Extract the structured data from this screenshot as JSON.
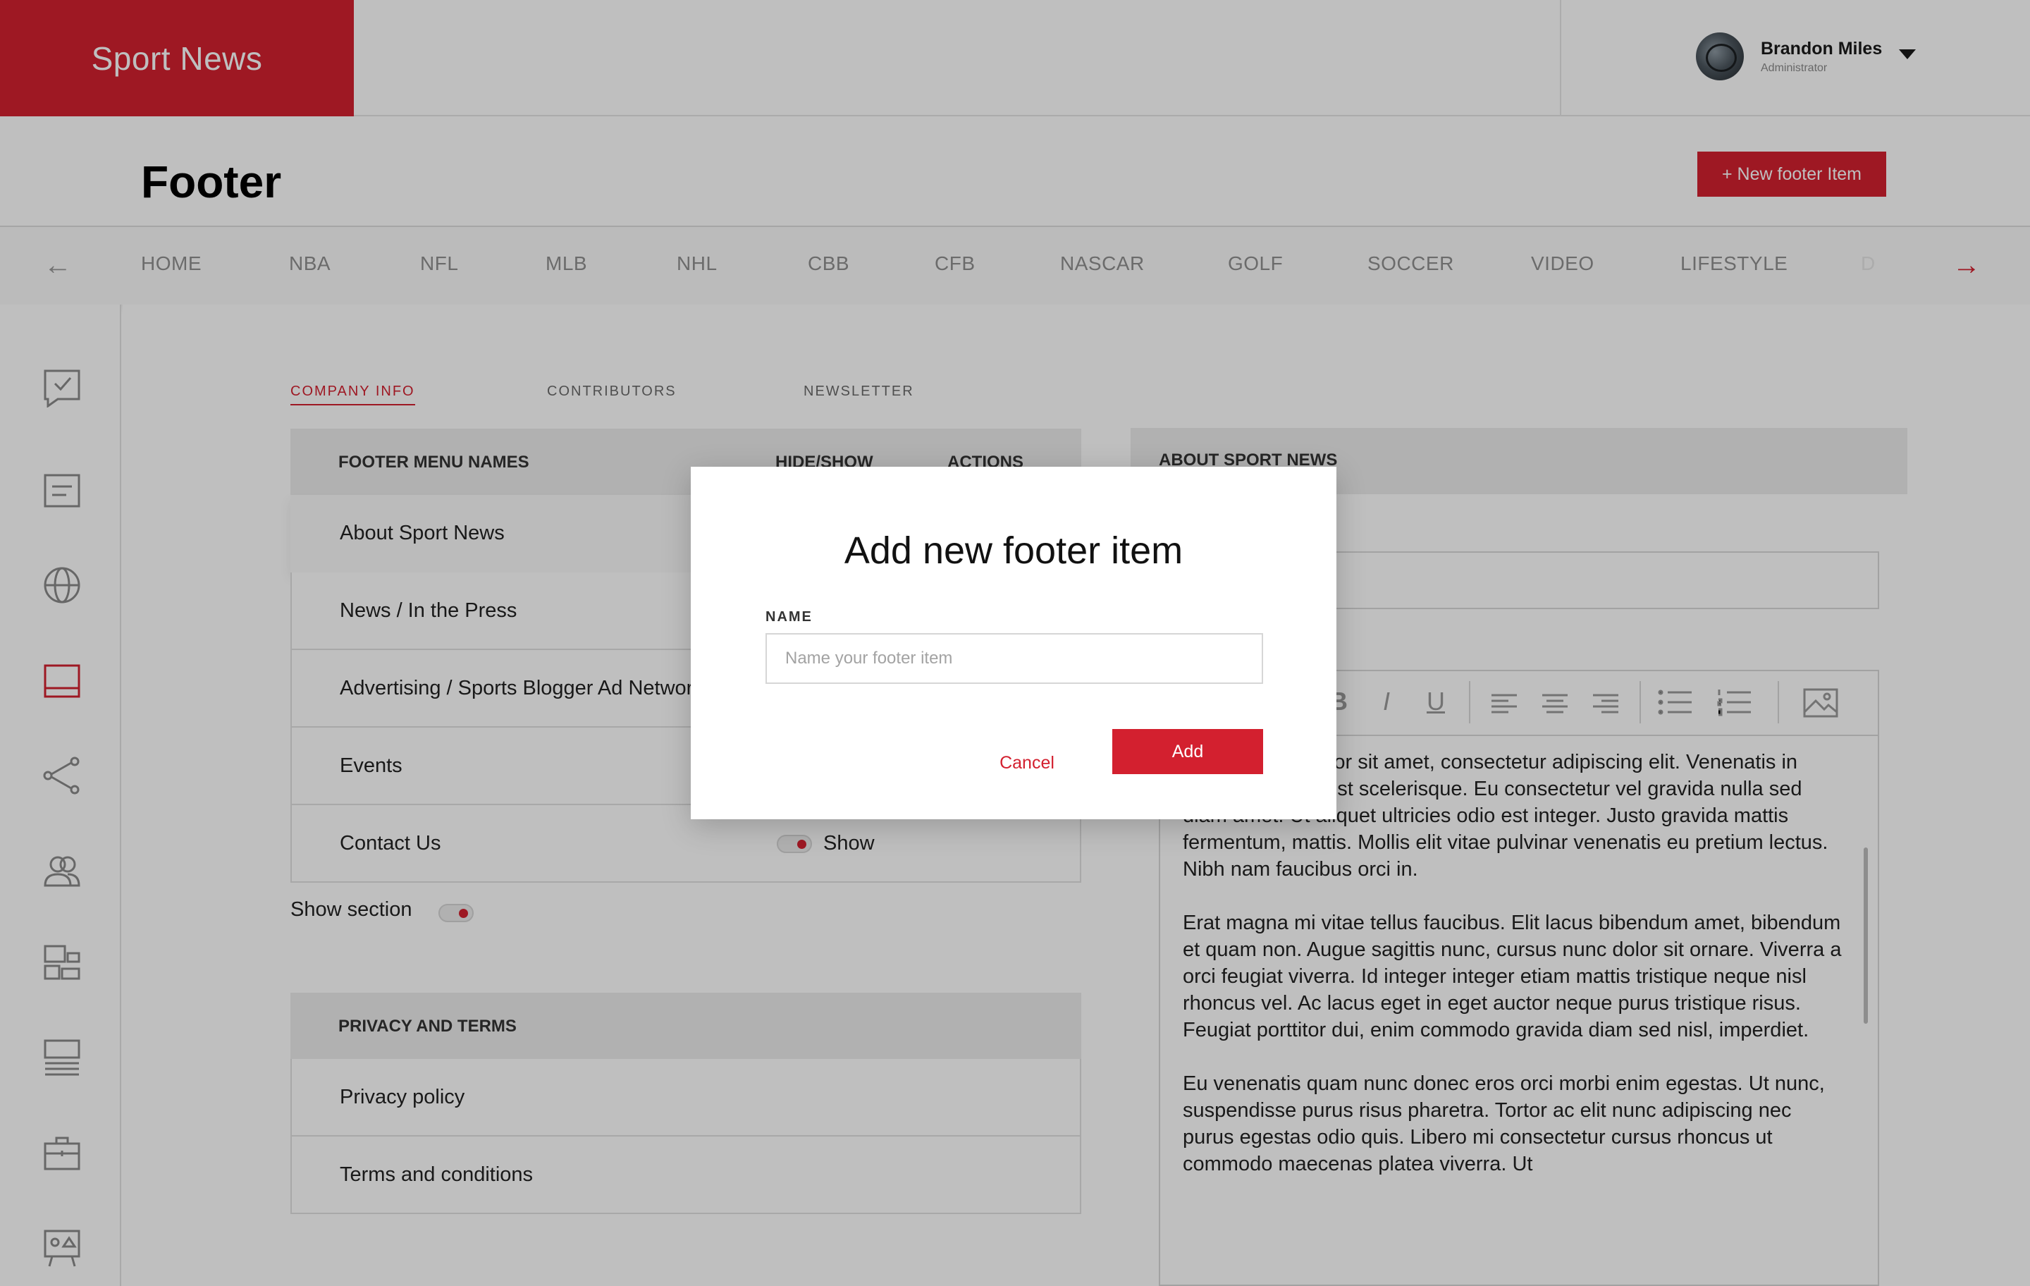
{
  "brand": {
    "name": "Sport News",
    "color": "#d3202f"
  },
  "user": {
    "name": "Brandon Miles",
    "role": "Administrator"
  },
  "page": {
    "title": "Footer",
    "new_button": "+ New footer Item"
  },
  "categories": [
    "HOME",
    "NBA",
    "NFL",
    "MLB",
    "NHL",
    "CBB",
    "CFB",
    "NASCAR",
    "GOLF",
    "SOCCER",
    "VIDEO",
    "LIFESTYLE",
    "D"
  ],
  "tabs": [
    {
      "label": "COMPANY INFO",
      "active": true
    },
    {
      "label": "CONTRIBUTORS",
      "active": false
    },
    {
      "label": "NEWSLETTER",
      "active": false
    }
  ],
  "footer_table": {
    "headers": [
      "FOOTER MENU NAMES",
      "HIDE/SHOW",
      "ACTIONS"
    ],
    "rows": [
      {
        "name": "About Sport News"
      },
      {
        "name": "News / In the Press"
      },
      {
        "name": "Advertising / Sports Blogger Ad Network"
      },
      {
        "name": "Events"
      },
      {
        "name": "Contact Us",
        "toggle": "Show"
      }
    ],
    "show_section_label": "Show section"
  },
  "privacy_table": {
    "header": "PRIVACY AND TERMS",
    "rows": [
      "Privacy policy",
      "Terms and conditions"
    ]
  },
  "about_panel": {
    "header": "ABOUT SPORT NEWS",
    "toolbar": [
      "B",
      "I",
      "U",
      "align-left-icon",
      "align-center-icon",
      "align-right-icon",
      "bullet-list-icon",
      "numbered-list-icon",
      "image-icon"
    ],
    "paragraphs": [
      "Lorem ipsum dolor sit amet, consectetur adipiscing elit. Venenatis in massa tristique est scelerisque. Eu consectetur vel gravida nulla sed diam amet. Ut aliquet ultricies odio est integer. Justo gravida mattis fermentum, mattis. Mollis elit vitae pulvinar venenatis eu pretium lectus. Nibh nam faucibus orci in.",
      "Erat magna mi vitae tellus faucibus. Elit lacus bibendum amet, bibendum et quam non. Augue sagittis nunc, cursus nunc dolor sit ornare. Viverra a orci feugiat viverra. Id integer integer etiam mattis tristique neque nisl rhoncus vel. Ac lacus eget in eget auctor neque purus tristique risus. Feugiat porttitor dui, enim commodo gravida diam sed nisl, imperdiet.",
      "Eu venenatis quam nunc donec eros orci morbi enim egestas. Ut nunc, suspendisse purus risus pharetra. Tortor ac elit nunc adipiscing nec purus egestas odio quis. Libero mi consectetur cursus rhoncus ut commodo maecenas platea viverra. Ut"
    ]
  },
  "modal": {
    "title": "Add new footer item",
    "field_label": "NAME",
    "placeholder": "Name your footer item",
    "value": "",
    "cancel": "Cancel",
    "add": "Add"
  }
}
